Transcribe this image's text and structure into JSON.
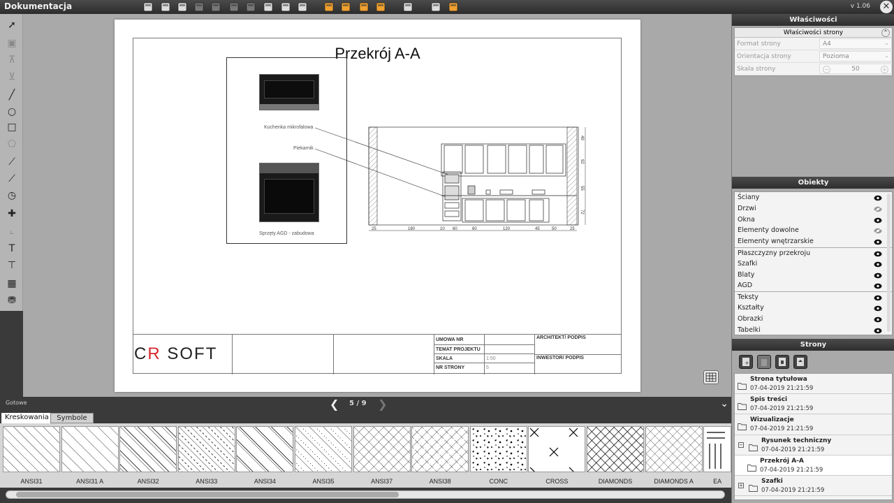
{
  "app": {
    "title": "Dokumentacja",
    "version": "v 1.06"
  },
  "toolbar_icons": [
    "save-icon",
    "save-as-icon",
    "print-icon",
    "undo-icon",
    "redo-icon",
    "copy-icon",
    "paste-icon",
    "edit-icon",
    "cut-icon",
    "settings-icon",
    "section-icon",
    "orbit-icon",
    "cross-section-icon",
    "lamp-icon",
    "measure-icon",
    "page-icon",
    "page-active-icon"
  ],
  "left_tools": [
    "pointer-icon",
    "text-frame-icon",
    "align-top-icon",
    "align-bottom-icon",
    "line-icon",
    "circle-icon",
    "rectangle-icon",
    "polygon-icon",
    "dimension-line-icon",
    "dimension-chain-icon",
    "angle-icon",
    "anchor-icon",
    "axis-icon",
    "text-icon",
    "text-label-icon",
    "table-icon",
    "stamp-icon"
  ],
  "document": {
    "page_title": "Przekrój A-A",
    "labels": {
      "microwave": "Kuchenka mikrofalowa",
      "oven": "Piekarnik",
      "agd_caption": "Sprzęty AGD - zabudowa"
    },
    "dims_bottom": [
      "25",
      "180",
      "10",
      "60",
      "60",
      "120",
      "45",
      "50",
      "25"
    ],
    "dims_right": [
      "49",
      "92",
      "55",
      "72"
    ],
    "title_block": {
      "logo_left": "C",
      "logo_red": "R",
      "logo_right": " SOFT",
      "umowa": "UMOWA NR",
      "temat": "TEMAT PROJEKTU",
      "skala_label": "SKALA",
      "skala_value": "1:50",
      "nr_label": "NR STRONY",
      "nr_value": "5",
      "architekt": "ARCHITEKT/ PODPIS",
      "inwestor": "INWESTOR/ PODPIS"
    }
  },
  "status": {
    "text": "Gotowe",
    "pager": "5 / 9"
  },
  "tabs": [
    {
      "label": "Kreskowania"
    },
    {
      "label": "Symbole"
    }
  ],
  "patterns": [
    "ANSI31",
    "ANSI31 A",
    "ANSI32",
    "ANSI33",
    "ANSI34",
    "ANSI35",
    "ANSI37",
    "ANSI38",
    "CONC",
    "CROSS",
    "DIAMONDS",
    "DIAMONDS A",
    "EA"
  ],
  "properties": {
    "header": "Właściwości",
    "section_title": "Właściwości strony",
    "rows": [
      {
        "label": "Format strony",
        "value": "A4"
      },
      {
        "label": "Orientacja strony",
        "value": "Pozioma"
      },
      {
        "label": "Skala strony",
        "value": "50"
      }
    ]
  },
  "objects": {
    "header": "Obiekty",
    "items": [
      {
        "label": "Ściany",
        "visible": true
      },
      {
        "label": "Drzwi",
        "visible": false
      },
      {
        "label": "Okna",
        "visible": true
      },
      {
        "label": "Elementy dowolne",
        "visible": false
      },
      {
        "label": "Elementy wnętrzarskie",
        "visible": true
      },
      {
        "label": "Płaszczyzny przekroju",
        "visible": true
      },
      {
        "label": "Szafki",
        "visible": true
      },
      {
        "label": "Blaty",
        "visible": true
      },
      {
        "label": "AGD",
        "visible": true
      },
      {
        "label": "Teksty",
        "visible": true
      },
      {
        "label": "Kształty",
        "visible": true
      },
      {
        "label": "Obrazki",
        "visible": true
      },
      {
        "label": "Tabelki",
        "visible": true
      }
    ]
  },
  "pages": {
    "header": "Strony",
    "items": [
      {
        "name": "Strona tytułowa",
        "date": "07-04-2019 21:21:59"
      },
      {
        "name": "Spis treści",
        "date": "07-04-2019 21:21:59"
      },
      {
        "name": "Wizualizacje",
        "date": "07-04-2019 21:21:59"
      },
      {
        "name": "Rysunek techniczny",
        "date": "07-04-2019 21:21:59"
      },
      {
        "name": "Przekrój A-A",
        "date": "07-04-2019 21:21:59"
      },
      {
        "name": "Szafki",
        "date": "07-04-2019 21:21:59"
      }
    ]
  }
}
